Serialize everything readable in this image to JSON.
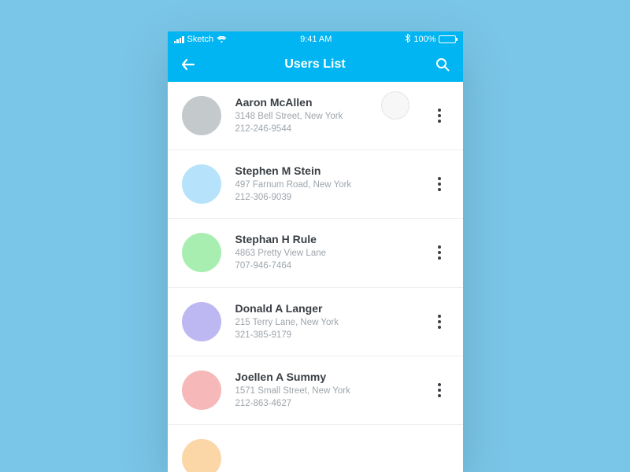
{
  "status": {
    "carrier": "Sketch",
    "time": "9:41 AM",
    "battery": "100%"
  },
  "header": {
    "title": "Users List"
  },
  "users": [
    {
      "name": "Aaron McAllen",
      "address": "3148 Bell Street, New York",
      "phone": "212-246-9544",
      "avatar_color": "#c4c9cc"
    },
    {
      "name": "Stephen M Stein",
      "address": "497 Farnum Road, New York",
      "phone": "212-306-9039",
      "avatar_color": "#b6e2fb"
    },
    {
      "name": "Stephan H Rule",
      "address": "4863 Pretty View Lane",
      "phone": "707-946-7464",
      "avatar_color": "#a8eeb1"
    },
    {
      "name": "Donald A Langer",
      "address": "215 Terry Lane, New York",
      "phone": "321-385-9179",
      "avatar_color": "#bdb7f2"
    },
    {
      "name": "Joellen A Summy",
      "address": "1571 Small Street, New York",
      "phone": "212-863-4627",
      "avatar_color": "#f6b8b8"
    }
  ],
  "partial_user": {
    "avatar_color": "#fbd7a8"
  }
}
